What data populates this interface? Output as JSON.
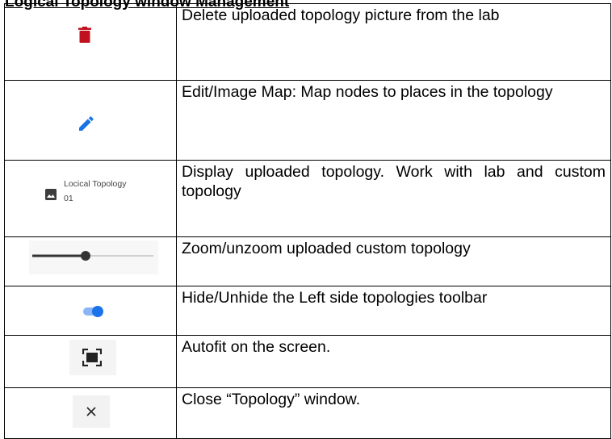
{
  "heading": "Logical Topology window Management",
  "colors": {
    "delete_icon": "#c0121e",
    "edit_icon": "#1a73e8",
    "toggle_on": "#1a73e8",
    "slider_track": "#333333"
  },
  "rows": [
    {
      "icon": "trash-icon",
      "description": "Delete uploaded topology picture from the lab"
    },
    {
      "icon": "pencil-icon",
      "description": "Edit/Image Map: Map nodes to places in the topology"
    },
    {
      "icon": "image-icon",
      "thumbnail_label": "Locical Topology 01",
      "description": "Display uploaded topology. Work with lab and custom topology"
    },
    {
      "icon": "zoom-slider",
      "slider_level": 0.45,
      "description": "Zoom/unzoom uploaded custom topology"
    },
    {
      "icon": "toggle-switch",
      "toggle_state": "on",
      "description": "Hide/Unhide the Left side topologies toolbar"
    },
    {
      "icon": "autofit-icon",
      "description": "Autofit on the screen."
    },
    {
      "icon": "close-icon",
      "description": "Close “Topology” window."
    }
  ]
}
